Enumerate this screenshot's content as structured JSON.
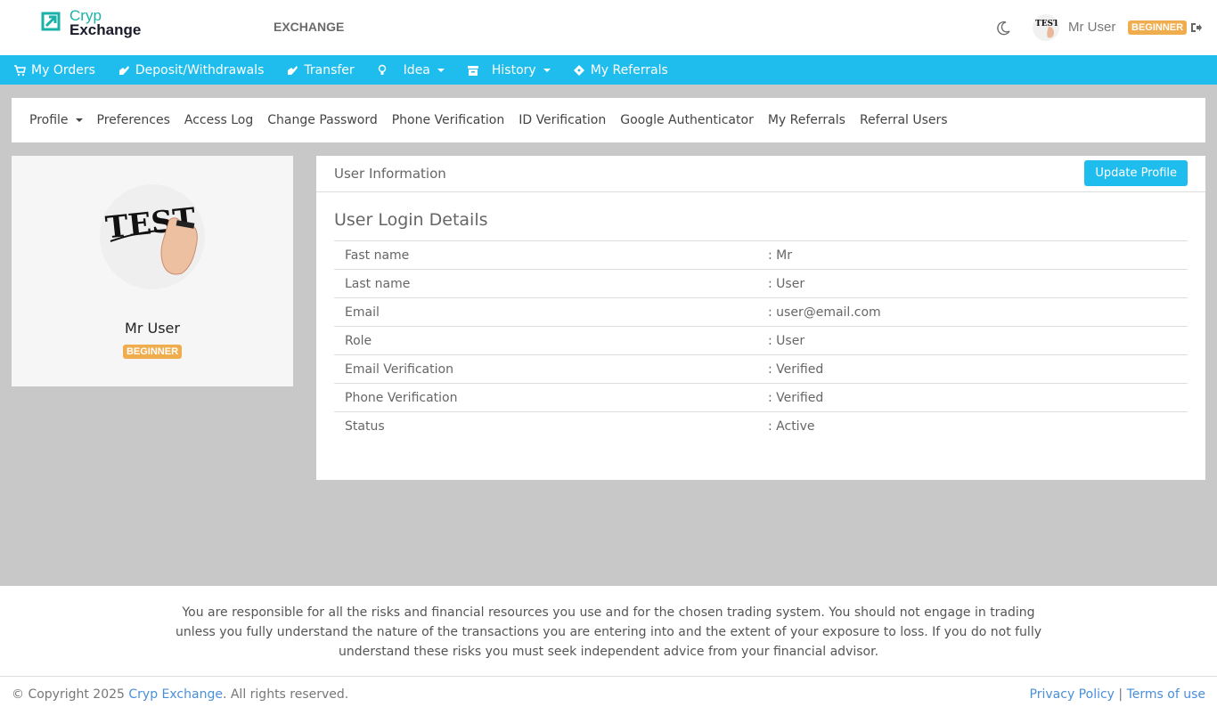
{
  "header": {
    "brand_line1": "Cryp",
    "brand_line2": "Exchange",
    "exchange_link": "EXCHANGE",
    "username": "Mr User",
    "level_badge": "BEGINNER",
    "icons": [
      "moon-icon",
      "avatar",
      "logout-icon"
    ]
  },
  "nav": {
    "items": [
      {
        "label": "My Orders",
        "icon": "cart-icon"
      },
      {
        "label": "Deposit/Withdrawals",
        "icon": "hand-icon"
      },
      {
        "label": "Transfer",
        "icon": "hand-icon"
      },
      {
        "label": "Idea",
        "icon": "lightbulb-icon",
        "dropdown": true
      },
      {
        "label": "History",
        "icon": "archive-icon",
        "dropdown": true
      },
      {
        "label": "My Referrals",
        "icon": "ticket-icon"
      }
    ]
  },
  "subnav": {
    "items": [
      {
        "label": "Profile",
        "dropdown": true
      },
      {
        "label": "Preferences"
      },
      {
        "label": "Access Log"
      },
      {
        "label": "Change Password"
      },
      {
        "label": "Phone Verification"
      },
      {
        "label": "ID Verification"
      },
      {
        "label": "Google Authenticator"
      },
      {
        "label": "My Referrals"
      },
      {
        "label": "Referral Users"
      }
    ]
  },
  "profile_card": {
    "name": "Mr User",
    "badge": "BEGINNER",
    "avatar_text": "TEST"
  },
  "info": {
    "title": "User Information",
    "update_button": "Update Profile",
    "section_title": "User Login Details",
    "rows": [
      {
        "label": "Fast name",
        "value": ": Mr"
      },
      {
        "label": "Last name",
        "value": ": User"
      },
      {
        "label": "Email",
        "value": ": user@email.com"
      },
      {
        "label": "Role",
        "value": ": User"
      },
      {
        "label": "Email Verification",
        "value": ": Verified"
      },
      {
        "label": "Phone Verification",
        "value": ": Verified"
      },
      {
        "label": "Status",
        "value": ": Active"
      }
    ]
  },
  "footer": {
    "disclaimer": "You are responsible for all the risks and financial resources you use and for the chosen trading system. You should not engage in trading unless you fully understand the nature of the transactions you are entering into and the extent of your exposure to loss. If you do not fully understand these risks you must seek independent advice from your financial advisor.",
    "copyright_prefix": "© Copyright 2025 ",
    "brand_link": "Cryp Exchange",
    "copyright_suffix": ". All rights reserved.",
    "privacy_link": "Privacy Policy",
    "separator": " | ",
    "terms_link": "Terms of use"
  },
  "colors": {
    "accent": "#1fbded",
    "brand_teal": "#1ab2a8",
    "badge": "#f0ad4e",
    "link": "#4a8fd9",
    "page_bg": "#c8c8c8"
  }
}
